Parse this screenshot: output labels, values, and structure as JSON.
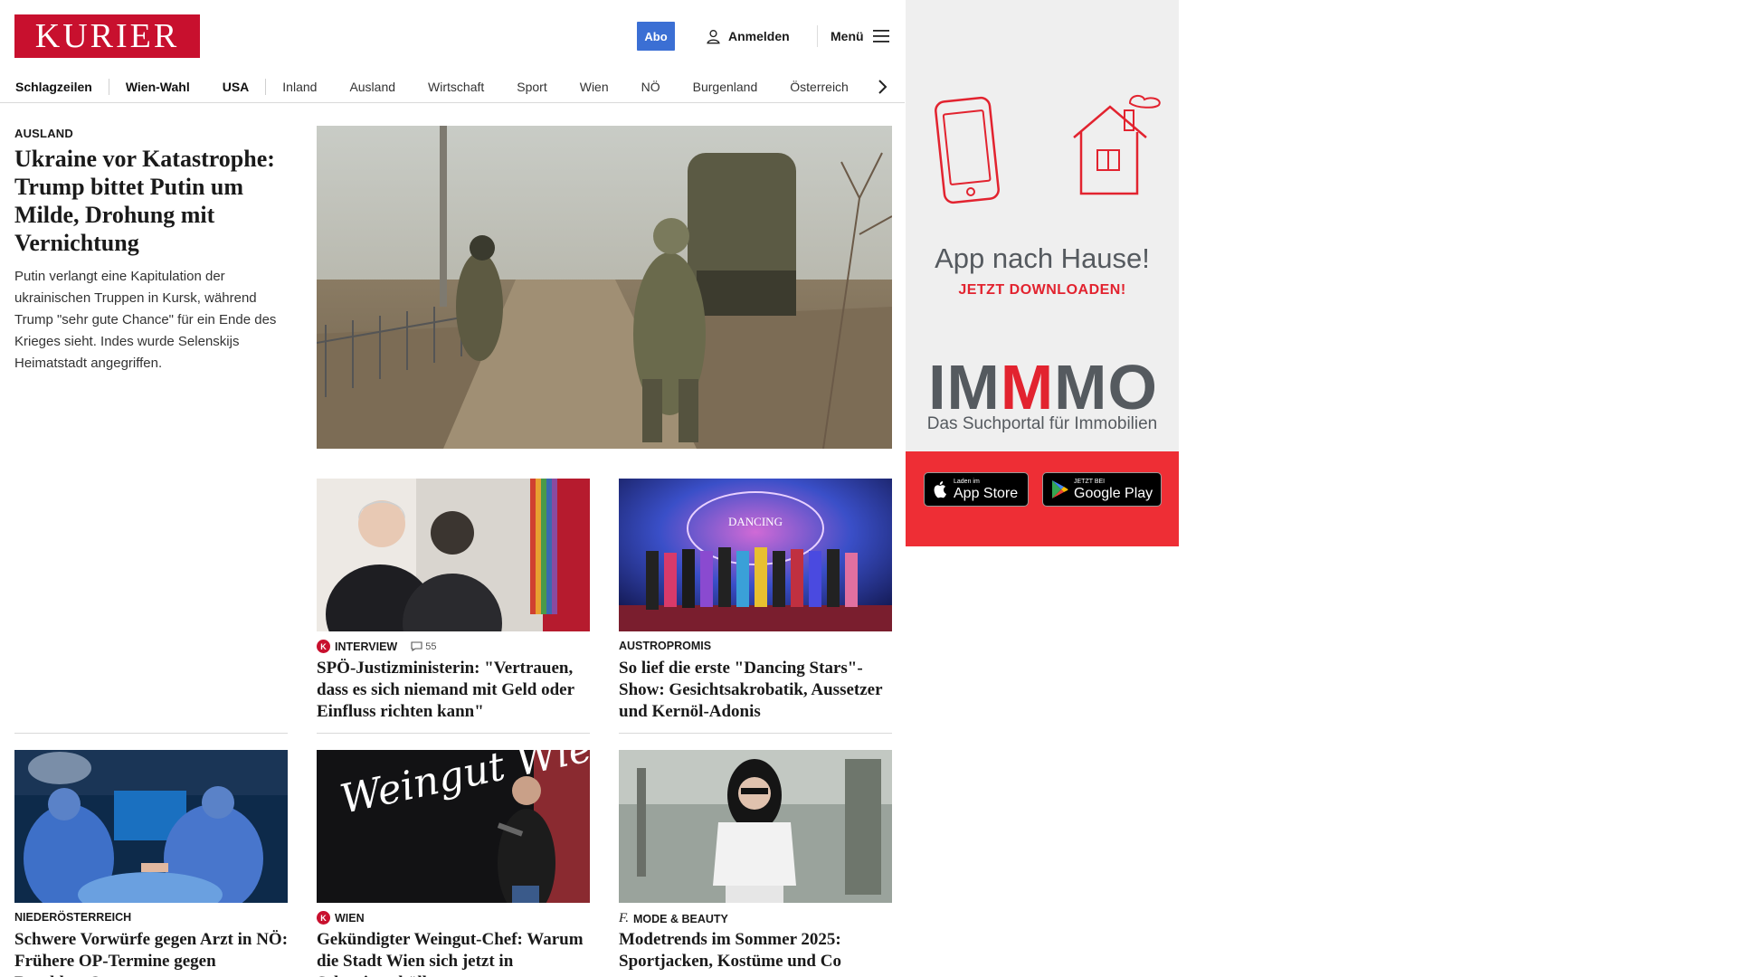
{
  "header": {
    "logo": "KURIER",
    "abo_label": "Abo",
    "login_label": "Anmelden",
    "menu_label": "Menü"
  },
  "nav": {
    "items": [
      "Schlagzeilen",
      "Wien-Wahl",
      "USA",
      "Inland",
      "Ausland",
      "Wirtschaft",
      "Sport",
      "Wien",
      "NÖ",
      "Burgenland",
      "Österreich"
    ]
  },
  "lead": {
    "kicker": "AUSLAND",
    "title": "Ukraine vor Katastrophe: Trump bittet Putin um Milde, Drohung mit Vernichtung",
    "text": "Putin verlangt eine Kapitulation der ukrainischen Truppen in Kursk, während Trump \"sehr gute Chance\" für ein Ende des Krieges sieht. Indes wurde Selenskijs Heimatstadt angegriffen."
  },
  "cards": [
    {
      "kicker": "INTERVIEW",
      "badge": "K",
      "comments": "55",
      "title": "SPÖ-Justizministerin: \"Vertrauen, dass es sich niemand mit Geld oder Einfluss richten kann\""
    },
    {
      "kicker": "AUSTROPROMIS",
      "title": "So lief die erste \"Dancing Stars\"-Show: Gesichtsakrobatik, Aussetzer und Kernöl-Adonis",
      "image_text": "DANCING"
    },
    {
      "kicker": "NIEDERÖSTERREICH",
      "title": "Schwere Vorwürfe gegen Arzt in NÖ: Frühere OP-Termine gegen Bezahlung?"
    },
    {
      "kicker": "WIEN",
      "badge": "K",
      "title": "Gekündigter Weingut-Chef: Warum die Stadt Wien sich jetzt in Schweigen hüllt",
      "image_text": "Weingut Wien Cobenzl"
    },
    {
      "kicker": "MODE & BEAUTY",
      "badge_text": "f.",
      "title": "Modetrends im Sommer 2025: Sportjacken, Kostüme und Co"
    }
  ],
  "ad": {
    "headline": "App nach Hause!",
    "cta": "JETZT DOWNLOADEN!",
    "brand_pre": "IM",
    "brand_red": "M",
    "brand_post": "MO",
    "brand_sub": "Das Suchportal für Immobilien",
    "appstore_small": "Laden im",
    "appstore_big": "App Store",
    "googleplay_small": "JETZT BEI",
    "googleplay_big": "Google Play"
  },
  "colors": {
    "brand_red": "#c8102e",
    "abo_blue": "#3b6fd4",
    "ad_red": "#ee2e35"
  }
}
